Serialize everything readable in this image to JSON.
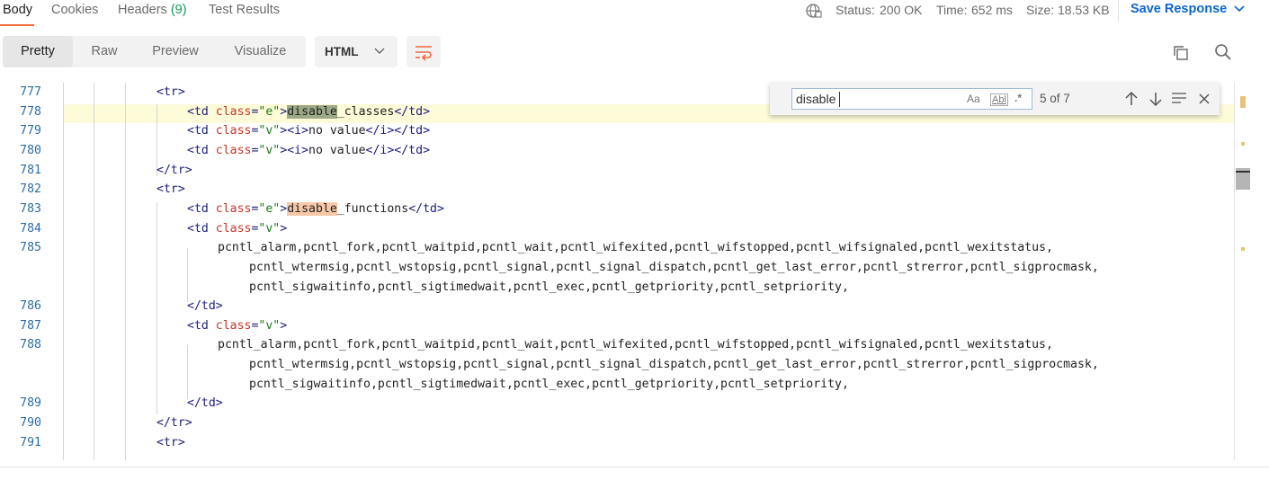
{
  "tabs": {
    "body": "Body",
    "cookies": "Cookies",
    "headers": "Headers",
    "headers_count": "(9)",
    "test_results": "Test Results"
  },
  "status": {
    "status_label": "Status:",
    "status_value": "200 OK",
    "time_label": "Time:",
    "time_value": "652 ms",
    "size_label": "Size:",
    "size_value": "18.53 KB"
  },
  "save_response": "Save Response",
  "view_modes": [
    "Pretty",
    "Raw",
    "Preview",
    "Visualize"
  ],
  "format": "HTML",
  "find": {
    "query": "disable",
    "case_icon": "Aa",
    "word_icon": "Abl",
    "regex_icon": ".*",
    "count": "5 of 7"
  },
  "lines": [
    {
      "num": "777",
      "tokens": [
        [
          "tag",
          "<tr>"
        ]
      ]
    },
    {
      "num": "778",
      "tokens": [
        [
          "tag",
          "<td "
        ],
        [
          "attr",
          "class"
        ],
        [
          "tag",
          "="
        ],
        [
          "str",
          "\"e\""
        ],
        [
          "tag",
          ">"
        ],
        [
          "m1",
          "disable"
        ],
        [
          "txt",
          "_classes"
        ],
        [
          "tag",
          "</td>"
        ]
      ]
    },
    {
      "num": "779",
      "tokens": [
        [
          "tag",
          "<td "
        ],
        [
          "attr",
          "class"
        ],
        [
          "tag",
          "="
        ],
        [
          "str",
          "\"v\""
        ],
        [
          "tag",
          "><i>"
        ],
        [
          "txt",
          "no value"
        ],
        [
          "tag",
          "</i></td>"
        ]
      ]
    },
    {
      "num": "780",
      "tokens": [
        [
          "tag",
          "<td "
        ],
        [
          "attr",
          "class"
        ],
        [
          "tag",
          "="
        ],
        [
          "str",
          "\"v\""
        ],
        [
          "tag",
          "><i>"
        ],
        [
          "txt",
          "no value"
        ],
        [
          "tag",
          "</i></td>"
        ]
      ]
    },
    {
      "num": "781",
      "tokens": [
        [
          "tag",
          "</tr>"
        ]
      ]
    },
    {
      "num": "782",
      "tokens": [
        [
          "tag",
          "<tr>"
        ]
      ]
    },
    {
      "num": "783",
      "tokens": [
        [
          "tag",
          "<td "
        ],
        [
          "attr",
          "class"
        ],
        [
          "tag",
          "="
        ],
        [
          "str",
          "\"e\""
        ],
        [
          "tag",
          ">"
        ],
        [
          "m2",
          "disable"
        ],
        [
          "txt",
          "_functions"
        ],
        [
          "tag",
          "</td>"
        ]
      ]
    },
    {
      "num": "784",
      "tokens": [
        [
          "tag",
          "<td "
        ],
        [
          "attr",
          "class"
        ],
        [
          "tag",
          "="
        ],
        [
          "str",
          "\"v\""
        ],
        [
          "tag",
          ">"
        ]
      ]
    },
    {
      "num": "785",
      "tokens": [
        [
          "txt",
          "pcntl_alarm,pcntl_fork,pcntl_waitpid,pcntl_wait,pcntl_wifexited,pcntl_wifstopped,pcntl_wifsignaled,pcntl_wexitstatus,"
        ]
      ]
    },
    {
      "num": "",
      "tokens": [
        [
          "txt",
          "pcntl_wtermsig,pcntl_wstopsig,pcntl_signal,pcntl_signal_dispatch,pcntl_get_last_error,pcntl_strerror,pcntl_sigprocmask,"
        ]
      ]
    },
    {
      "num": "",
      "tokens": [
        [
          "txt",
          "pcntl_sigwaitinfo,pcntl_sigtimedwait,pcntl_exec,pcntl_getpriority,pcntl_setpriority,"
        ]
      ]
    },
    {
      "num": "786",
      "tokens": [
        [
          "tag",
          "</td>"
        ]
      ]
    },
    {
      "num": "787",
      "tokens": [
        [
          "tag",
          "<td "
        ],
        [
          "attr",
          "class"
        ],
        [
          "tag",
          "="
        ],
        [
          "str",
          "\"v\""
        ],
        [
          "tag",
          ">"
        ]
      ]
    },
    {
      "num": "788",
      "tokens": [
        [
          "txt",
          "pcntl_alarm,pcntl_fork,pcntl_waitpid,pcntl_wait,pcntl_wifexited,pcntl_wifstopped,pcntl_wifsignaled,pcntl_wexitstatus,"
        ]
      ]
    },
    {
      "num": "",
      "tokens": [
        [
          "txt",
          "pcntl_wtermsig,pcntl_wstopsig,pcntl_signal,pcntl_signal_dispatch,pcntl_get_last_error,pcntl_strerror,pcntl_sigprocmask,"
        ]
      ]
    },
    {
      "num": "",
      "tokens": [
        [
          "txt",
          "pcntl_sigwaitinfo,pcntl_sigtimedwait,pcntl_exec,pcntl_getpriority,pcntl_setpriority,"
        ]
      ]
    },
    {
      "num": "789",
      "tokens": [
        [
          "tag",
          "</td>"
        ]
      ]
    },
    {
      "num": "790",
      "tokens": [
        [
          "tag",
          "</tr>"
        ]
      ]
    },
    {
      "num": "791",
      "tokens": [
        [
          "tag",
          "<tr>"
        ]
      ]
    }
  ],
  "colors": {
    "accent": "#f26b3a",
    "link": "#0b66c8",
    "status_ok": "#0f9d58",
    "current_match": "#9da886",
    "other_match": "#f7c8a8",
    "line_highlight": "#fdfbd8"
  },
  "icons": [
    "globe-icon",
    "chevron-down-icon",
    "wrap-lines-icon",
    "copy-icon",
    "search-icon",
    "arrow-up-icon",
    "arrow-down-icon",
    "find-in-selection-icon",
    "close-icon"
  ]
}
